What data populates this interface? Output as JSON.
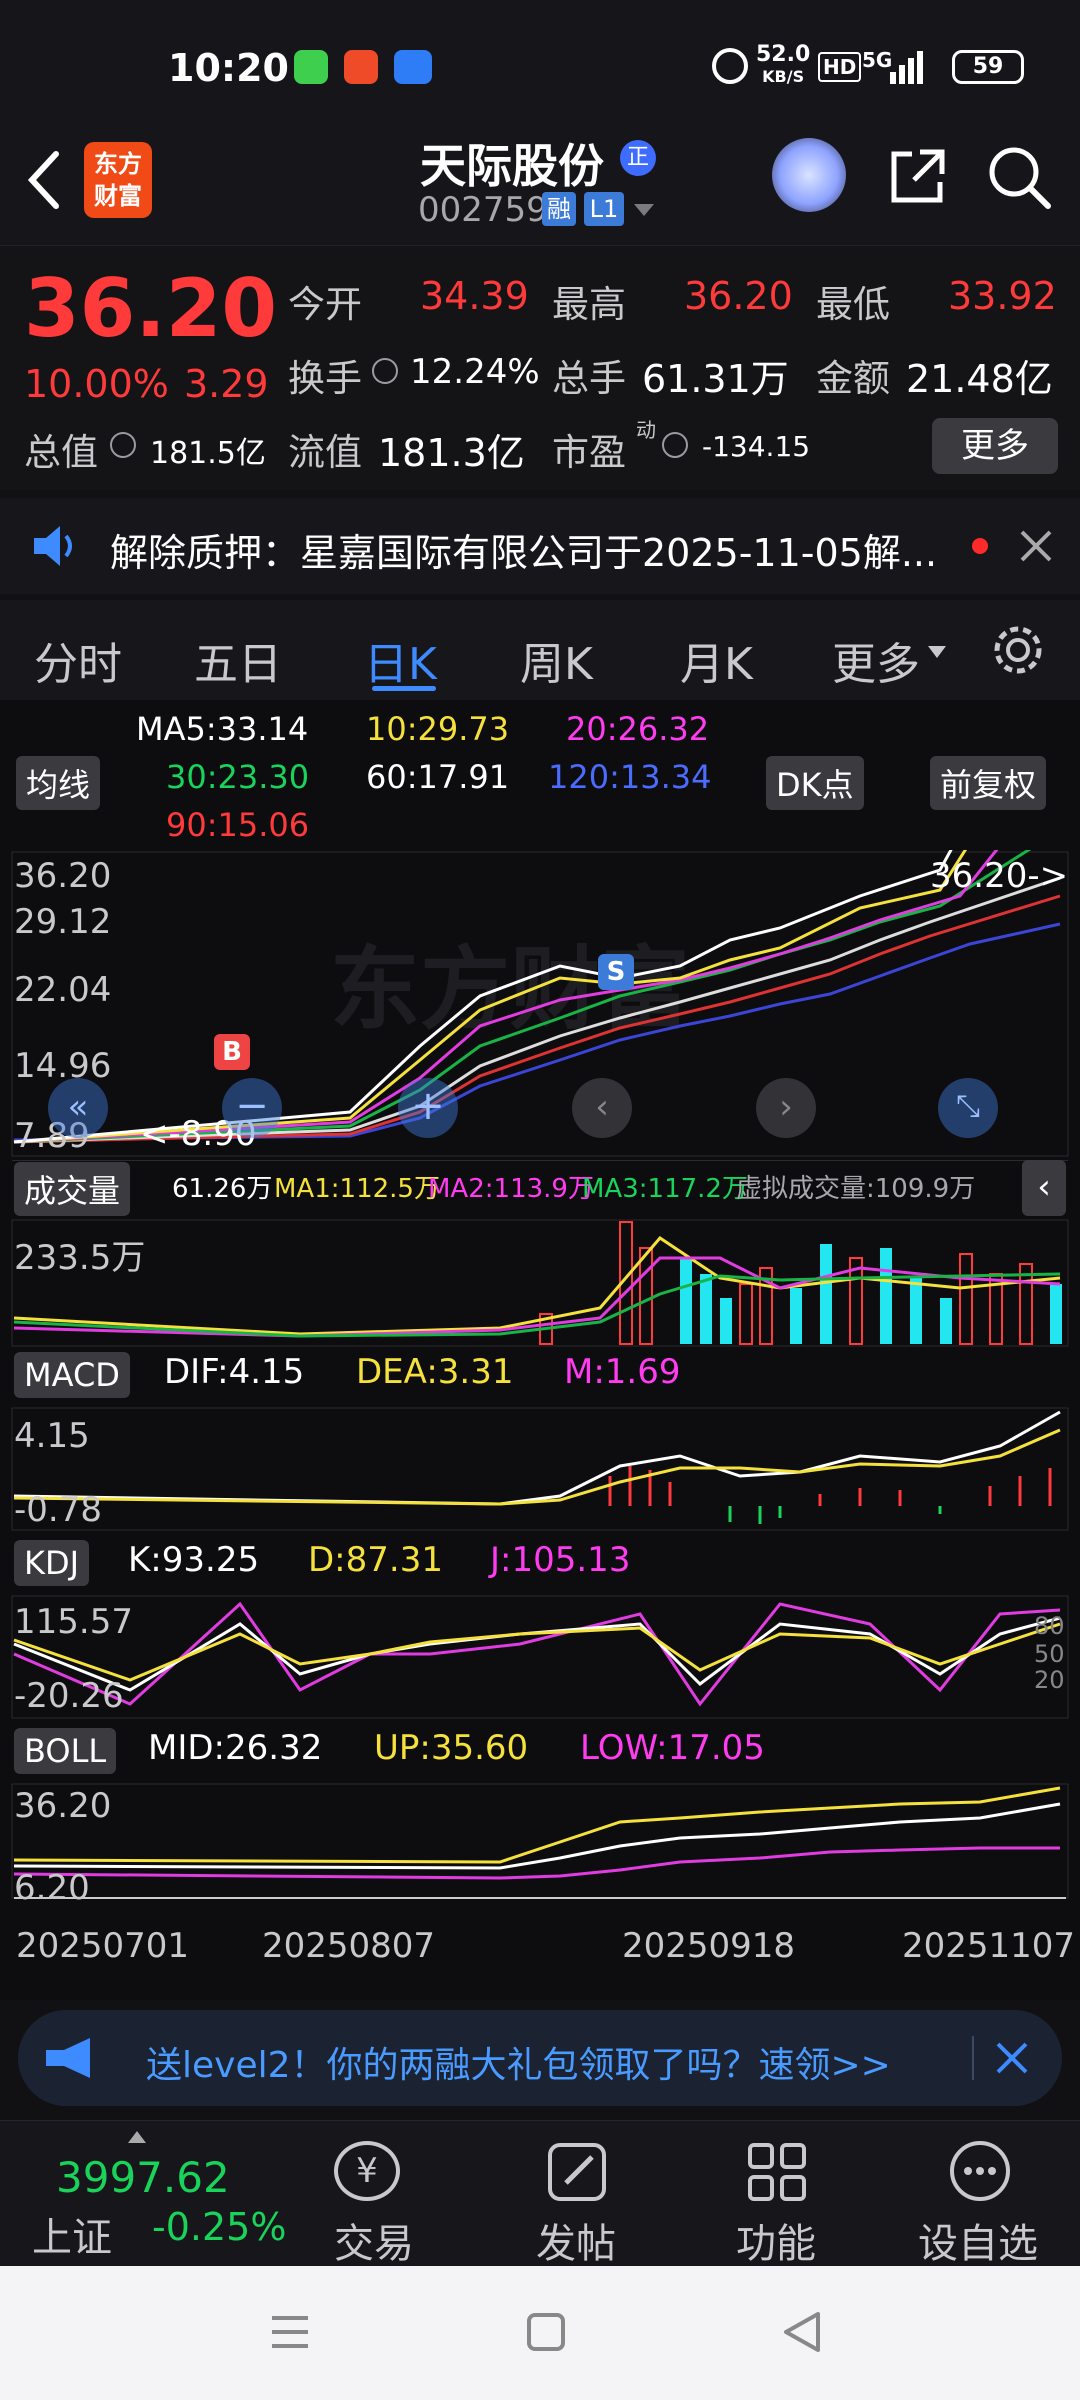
{
  "status": {
    "time": "10:20",
    "speed_value": "52.0",
    "speed_unit": "KB/S",
    "hd": "HD",
    "net": "5G",
    "battery": "59"
  },
  "header": {
    "logo_line1": "东方",
    "logo_line2": "财富",
    "title": "天际股份",
    "title_badge": "正",
    "code": "002759",
    "badge_rong": "融",
    "badge_level": "L1"
  },
  "quote": {
    "price": "36.20",
    "change_pct": "10.00%",
    "change": "3.29",
    "open_label": "今开",
    "open": "34.39",
    "high_label": "最高",
    "high": "36.20",
    "low_label": "最低",
    "low": "33.92",
    "turnover_label": "换手",
    "turnover": "12.24%",
    "volume_label": "总手",
    "volume": "61.31万",
    "amount_label": "金额",
    "amount": "21.48亿",
    "mktcap_label": "总值",
    "mktcap": "181.5亿",
    "float_label": "流值",
    "float": "181.3亿",
    "pe_label": "市盈",
    "pe_sup": "动",
    "pe": "-134.15",
    "more": "更多"
  },
  "notice": {
    "text": "解除质押：星嘉国际有限公司于2025-11-05解..."
  },
  "tabs": [
    "分时",
    "五日",
    "日K",
    "周K",
    "月K",
    "更多"
  ],
  "ma": {
    "selector": "均线",
    "ma5": "MA5:33.14",
    "ma10": "10:29.73",
    "ma20": "20:26.32",
    "ma30": "30:23.30",
    "ma60": "60:17.91",
    "ma120": "120:13.34",
    "ma90": "90:15.06",
    "dk": "DK点",
    "fq": "前复权"
  },
  "kline": {
    "y1": "36.20",
    "y2": "29.12",
    "y3": "22.04",
    "y4": "14.96",
    "y5": "7.89",
    "last": "36.20->",
    "low_mark": "<-8.90",
    "marker_b": "B",
    "marker_s": "S",
    "watermark": "东方财富"
  },
  "volume": {
    "selector": "成交量",
    "v": "61.26万",
    "ma1": "MA1:112.5万",
    "ma2": "MA2:113.9万",
    "ma3": "MA3:117.2万",
    "virtual": "虚拟成交量:109.9万",
    "ymax": "233.5万"
  },
  "macd": {
    "selector": "MACD",
    "dif": "DIF:4.15",
    "dea": "DEA:3.31",
    "m": "M:1.69",
    "ymax": "4.15",
    "ymin": "-0.78"
  },
  "kdj": {
    "selector": "KDJ",
    "k": "K:93.25",
    "d": "D:87.31",
    "j": "J:105.13",
    "ymax": "115.57",
    "ymin": "-20.26",
    "t80": "80",
    "t50": "50",
    "t20": "20"
  },
  "boll": {
    "selector": "BOLL",
    "mid": "MID:26.32",
    "up": "UP:35.60",
    "low": "LOW:17.05",
    "ymax": "36.20",
    "ymin": "6.20"
  },
  "dates": [
    "20250701",
    "20250807",
    "20250918",
    "20251107"
  ],
  "banner": {
    "text": "送level2！你的两融大礼包领取了吗？速领>>"
  },
  "bottom": {
    "index_value": "3997.62",
    "index_name": "上证",
    "index_change": "-0.25%",
    "trade": "交易",
    "post": "发帖",
    "func": "功能",
    "fav": "设自选"
  },
  "colors": {
    "up": "#ff3a3a",
    "down": "#19d35a",
    "accent": "#3d8bff",
    "cyan": "#23e6f0"
  }
}
